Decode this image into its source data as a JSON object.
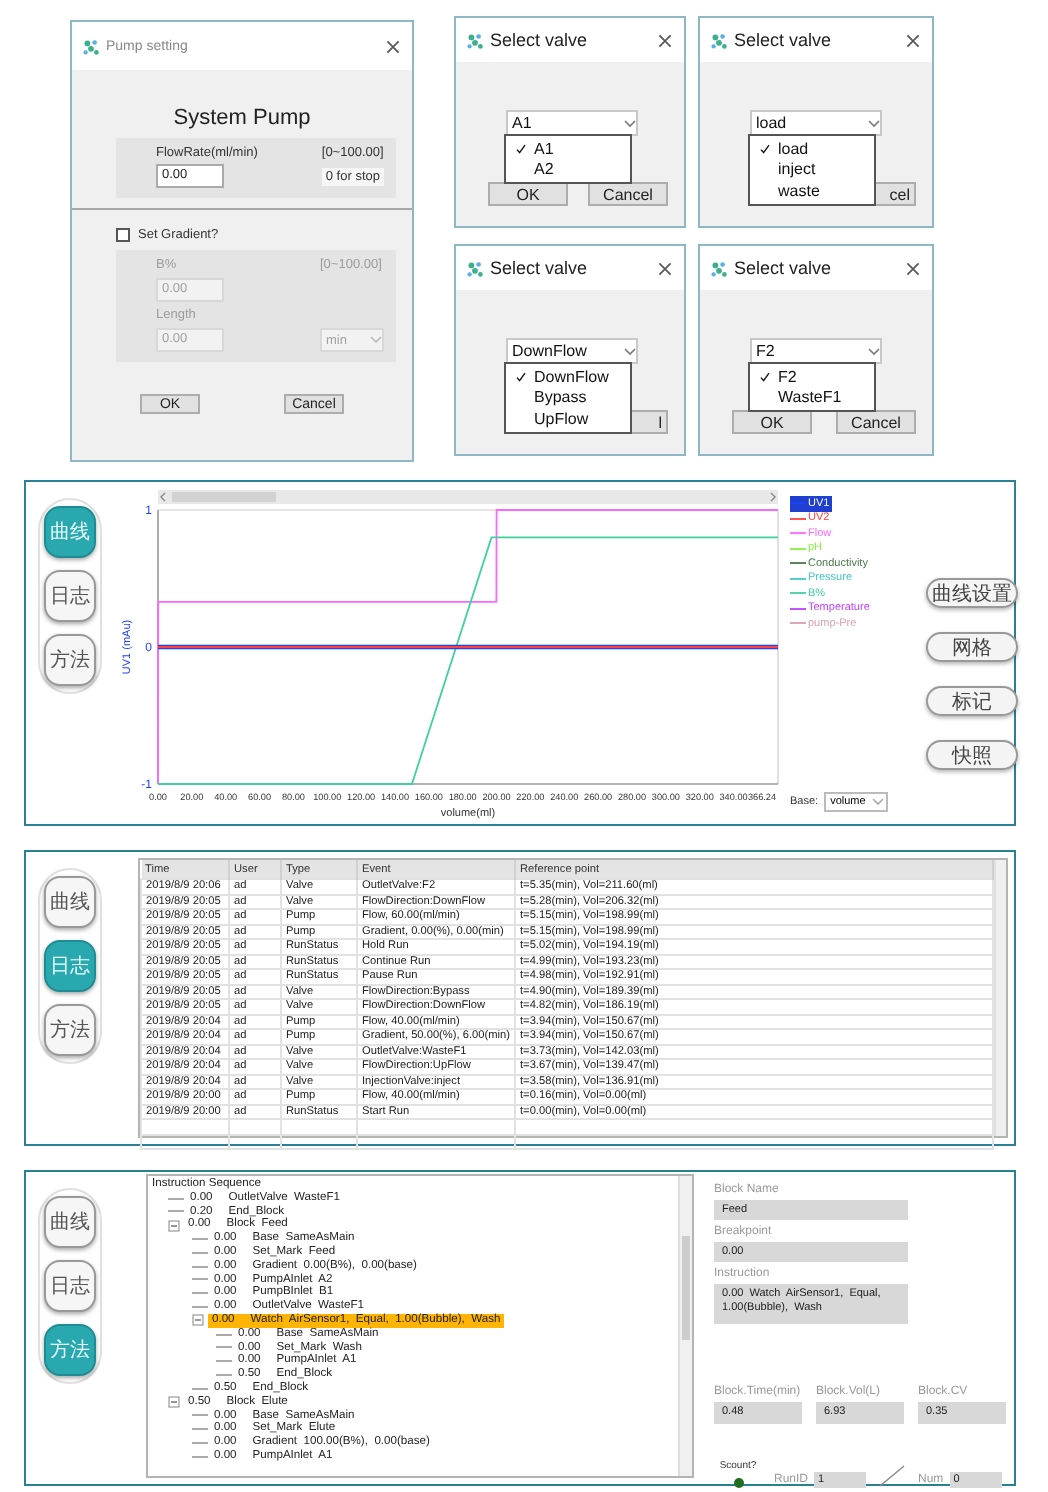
{
  "pump_dialog": {
    "title": "Pump setting",
    "heading": "System Pump",
    "flow_label": "FlowRate(ml/min)",
    "flow_range": "[0~100.00]",
    "flow_value": "0.00",
    "flow_hint": "0 for stop",
    "gradient_label": "Set Gradient?",
    "gradient_checked": false,
    "b_label": "B%",
    "b_range": "[0~100.00]",
    "b_value": "0.00",
    "length_label": "Length",
    "length_value": "0.00",
    "unit": "min",
    "buttons": [
      "OK",
      "Cancel"
    ]
  },
  "valve_dialogs": [
    {
      "title": "Select valve",
      "value": "A1",
      "options": [
        {
          "label": "A1",
          "selected": true
        },
        {
          "label": "A2",
          "selected": false
        }
      ],
      "buttons": [
        {
          "label": "OK",
          "clipped": false
        },
        {
          "label": "Cancel",
          "clipped": false
        }
      ]
    },
    {
      "title": "Select valve",
      "value": "load",
      "options": [
        {
          "label": "load",
          "selected": true
        },
        {
          "label": "inject",
          "selected": false
        },
        {
          "label": "waste",
          "selected": false
        }
      ],
      "buttons": [
        {
          "label": "cel",
          "clipped": true
        }
      ]
    },
    {
      "title": "Select valve",
      "value": "DownFlow",
      "options": [
        {
          "label": "DownFlow",
          "selected": true
        },
        {
          "label": "Bypass",
          "selected": false
        },
        {
          "label": "UpFlow",
          "selected": false
        }
      ],
      "buttons": [
        {
          "label": "l",
          "clipped": true
        }
      ]
    },
    {
      "title": "Select valve",
      "value": "F2",
      "options": [
        {
          "label": "F2",
          "selected": true
        },
        {
          "label": "WasteF1",
          "selected": false
        }
      ],
      "buttons": [
        {
          "label": "OK",
          "clipped": false
        },
        {
          "label": "Cancel",
          "clipped": false
        }
      ]
    }
  ],
  "chart_panel": {
    "nav": [
      {
        "label": "曲线",
        "selected": true
      },
      {
        "label": "日志",
        "selected": false
      },
      {
        "label": "方法",
        "selected": false
      }
    ],
    "chart_data": {
      "type": "line",
      "legend": "right",
      "xlabel": "volume(ml)",
      "ylabel": "UV1 (mAu)",
      "x": [
        0,
        0.1,
        150,
        197,
        199.9,
        200,
        366.24
      ],
      "xlim": [
        0,
        366.24
      ],
      "ylim": [
        -1,
        1
      ],
      "xticks": [
        {
          "value": 0,
          "label": "0.00"
        },
        {
          "value": 20,
          "label": "20.00"
        },
        {
          "value": 40,
          "label": "40.00"
        },
        {
          "value": 60,
          "label": "60.00"
        },
        {
          "value": 80,
          "label": "80.00"
        },
        {
          "value": 100,
          "label": "100.00"
        },
        {
          "value": 120,
          "label": "120.00"
        },
        {
          "value": 140,
          "label": "140.00"
        },
        {
          "value": 160,
          "label": "160.00"
        },
        {
          "value": 180,
          "label": "180.00"
        },
        {
          "value": 200,
          "label": "200.00"
        },
        {
          "value": 220,
          "label": "220.00"
        },
        {
          "value": 240,
          "label": "240.00"
        },
        {
          "value": 260,
          "label": "260.00"
        },
        {
          "value": 280,
          "label": "280.00"
        },
        {
          "value": 300,
          "label": "300.00"
        },
        {
          "value": 320,
          "label": "320.00"
        },
        {
          "value": 340,
          "label": "340.00"
        },
        {
          "value": 366.24,
          "label": "366.24"
        }
      ],
      "yticks": [
        -1,
        0,
        1
      ],
      "series": [
        {
          "name": "UV1",
          "color": "#2040ff",
          "values": [
            0,
            0,
            0,
            0,
            0,
            0,
            0
          ]
        },
        {
          "name": "UV2",
          "color": "#ff4040",
          "values": [
            0,
            0,
            0,
            0,
            0,
            0,
            0
          ]
        },
        {
          "name": "Flow",
          "color": "#ff66ff",
          "values": [
            -1,
            0.33,
            0.33,
            0.33,
            0.33,
            1,
            1
          ]
        },
        {
          "name": "pH",
          "color": "#88ee44",
          "values": [
            null,
            null,
            null,
            null,
            null,
            null,
            null
          ]
        },
        {
          "name": "Conductivity",
          "color": "#4a7a4a",
          "values": [
            null,
            null,
            null,
            null,
            null,
            null,
            null
          ]
        },
        {
          "name": "Pressure",
          "color": "#40c8c8",
          "values": [
            null,
            null,
            null,
            null,
            null,
            null,
            null
          ]
        },
        {
          "name": "B%",
          "color": "#40d0a0",
          "values": [
            -1,
            -1,
            -1,
            0.8,
            0.8,
            0.8,
            0.8
          ]
        },
        {
          "name": "Temperature",
          "color": "#c040ff",
          "values": [
            null,
            null,
            null,
            null,
            null,
            null,
            null
          ]
        },
        {
          "name": "pump-Pre",
          "color": "#d8a0b0",
          "values": [
            null,
            null,
            null,
            null,
            null,
            null,
            null
          ]
        }
      ]
    },
    "legend": [
      {
        "selected": true
      },
      {
        "selected": false
      },
      {
        "selected": false
      },
      {
        "selected": false
      },
      {
        "selected": false
      },
      {
        "selected": false
      },
      {
        "selected": false
      },
      {
        "selected": false
      },
      {
        "selected": false
      }
    ],
    "base_label": "Base:",
    "base_value": "volume",
    "actions": [
      "曲线设置",
      "网格",
      "标记",
      "快照"
    ]
  },
  "log_panel": {
    "nav": [
      {
        "label": "曲线",
        "selected": false
      },
      {
        "label": "日志",
        "selected": true
      },
      {
        "label": "方法",
        "selected": false
      }
    ],
    "columns": [
      "Time",
      "User",
      "Type",
      "Event",
      "Reference point"
    ],
    "rows": [
      [
        "2019/8/9 20:06",
        "ad",
        "Valve",
        "OutletValve:F2",
        "t=5.35(min), Vol=211.60(ml)"
      ],
      [
        "2019/8/9 20:05",
        "ad",
        "Valve",
        "FlowDirection:DownFlow",
        "t=5.28(min), Vol=206.32(ml)"
      ],
      [
        "2019/8/9 20:05",
        "ad",
        "Pump",
        "Flow, 60.00(ml/min)",
        "t=5.15(min), Vol=198.99(ml)"
      ],
      [
        "2019/8/9 20:05",
        "ad",
        "Pump",
        "Gradient, 0.00(%), 0.00(min)",
        "t=5.15(min), Vol=198.99(ml)"
      ],
      [
        "2019/8/9 20:05",
        "ad",
        "RunStatus",
        "Hold Run",
        "t=5.02(min), Vol=194.19(ml)"
      ],
      [
        "2019/8/9 20:05",
        "ad",
        "RunStatus",
        "Continue Run",
        "t=4.99(min), Vol=193.23(ml)"
      ],
      [
        "2019/8/9 20:05",
        "ad",
        "RunStatus",
        "Pause Run",
        "t=4.98(min), Vol=192.91(ml)"
      ],
      [
        "2019/8/9 20:05",
        "ad",
        "Valve",
        "FlowDirection:Bypass",
        "t=4.90(min), Vol=189.39(ml)"
      ],
      [
        "2019/8/9 20:05",
        "ad",
        "Valve",
        "FlowDirection:DownFlow",
        "t=4.82(min), Vol=186.19(ml)"
      ],
      [
        "2019/8/9 20:04",
        "ad",
        "Pump",
        "Flow, 40.00(ml/min)",
        "t=3.94(min), Vol=150.67(ml)"
      ],
      [
        "2019/8/9 20:04",
        "ad",
        "Pump",
        "Gradient, 50.00(%), 6.00(min)",
        "t=3.94(min), Vol=150.67(ml)"
      ],
      [
        "2019/8/9 20:04",
        "ad",
        "Valve",
        "OutletValve:WasteF1",
        "t=3.73(min), Vol=142.03(ml)"
      ],
      [
        "2019/8/9 20:04",
        "ad",
        "Valve",
        "FlowDirection:UpFlow",
        "t=3.67(min), Vol=139.47(ml)"
      ],
      [
        "2019/8/9 20:04",
        "ad",
        "Valve",
        "InjectionValve:inject",
        "t=3.58(min), Vol=136.91(ml)"
      ],
      [
        "2019/8/9 20:00",
        "ad",
        "Pump",
        "Flow, 40.00(ml/min)",
        "t=0.16(min), Vol=0.00(ml)"
      ],
      [
        "2019/8/9 20:00",
        "ad",
        "RunStatus",
        "Start Run",
        "t=0.00(min), Vol=0.00(ml)"
      ]
    ]
  },
  "method_panel": {
    "nav": [
      {
        "label": "曲线",
        "selected": false
      },
      {
        "label": "日志",
        "selected": false
      },
      {
        "label": "方法",
        "selected": true
      }
    ],
    "tree": {
      "title": "Instruction Sequence",
      "items": [
        {
          "time": "0.00",
          "text": "OutletValve  WasteF1",
          "selected": false
        },
        {
          "time": "0.20",
          "text": "End_Block",
          "selected": false
        },
        {
          "time": "0.00",
          "text": "Block  Feed",
          "selected": false,
          "expanded": true,
          "children": [
            {
              "time": "0.00",
              "text": "Base  SameAsMain",
              "selected": false
            },
            {
              "time": "0.00",
              "text": "Set_Mark  Feed",
              "selected": false
            },
            {
              "time": "0.00",
              "text": "Gradient  0.00(B%),  0.00(base)",
              "selected": false
            },
            {
              "time": "0.00",
              "text": "PumpAInlet  A2",
              "selected": false
            },
            {
              "time": "0.00",
              "text": "PumpBInlet  B1",
              "selected": false
            },
            {
              "time": "0.00",
              "text": "OutletValve  WasteF1",
              "selected": false
            },
            {
              "time": "0.00",
              "text": "Watch  AirSensor1,  Equal,  1.00(Bubble),  Wash",
              "selected": true,
              "expanded": true,
              "children": [
                {
                  "time": "0.00",
                  "text": "Base  SameAsMain",
                  "selected": false
                },
                {
                  "time": "0.00",
                  "text": "Set_Mark  Wash",
                  "selected": false
                },
                {
                  "time": "0.00",
                  "text": "PumpAInlet  A1",
                  "selected": false
                },
                {
                  "time": "0.50",
                  "text": "End_Block",
                  "selected": false
                }
              ]
            },
            {
              "time": "0.50",
              "text": "End_Block",
              "selected": false
            }
          ]
        },
        {
          "time": "0.50",
          "text": "Block  Elute",
          "selected": false,
          "expanded": true,
          "children": [
            {
              "time": "0.00",
              "text": "Base  SameAsMain",
              "selected": false
            },
            {
              "time": "0.00",
              "text": "Set_Mark  Elute",
              "selected": false
            },
            {
              "time": "0.00",
              "text": "Gradient  100.00(B%),  0.00(base)",
              "selected": false
            },
            {
              "time": "0.00",
              "text": "PumpAInlet  A1",
              "selected": false
            }
          ]
        }
      ]
    },
    "details": {
      "fields": [
        {
          "kind": "line",
          "label": "Block Name",
          "value": "Feed"
        },
        {
          "kind": "line",
          "label": "Breakpoint",
          "value": "0.00"
        },
        {
          "kind": "multiline",
          "label": "Instruction",
          "value": "0.00  Watch  AirSensor1,  Equal,  1.00(Bubble),  Wash"
        }
      ],
      "stats": [
        {
          "label": "Block.Time(min)",
          "value": "0.48"
        },
        {
          "label": "Block.Vol(L)",
          "value": "6.93"
        },
        {
          "label": "Block.CV",
          "value": "0.35"
        }
      ],
      "scount": {
        "label": "Scount?",
        "on": true
      },
      "run_id": {
        "label": "RunID",
        "value": "1"
      },
      "num": {
        "label": "Num",
        "value": "0"
      }
    }
  }
}
